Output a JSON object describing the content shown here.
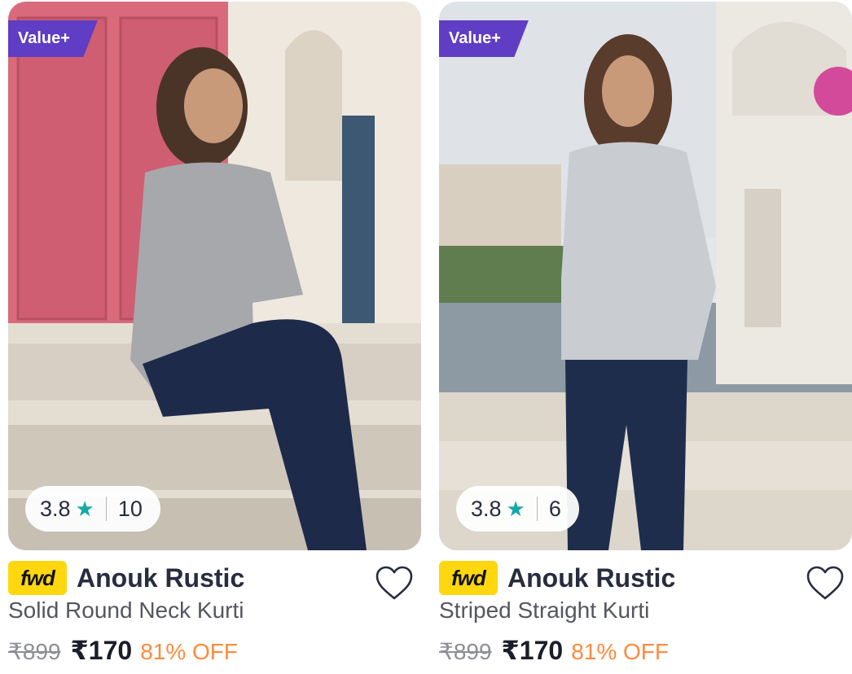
{
  "products": [
    {
      "badge": "Value+",
      "rating": "3.8",
      "star": "★",
      "rating_count": "10",
      "brand_logo": "fwd",
      "brand": "Anouk Rustic",
      "title": "Solid Round Neck Kurti",
      "mrp": "₹899",
      "price": "₹170",
      "discount": "81% OFF",
      "wishlist_icon": "heart-outline-icon"
    },
    {
      "badge": "Value+",
      "rating": "3.8",
      "star": "★",
      "rating_count": "6",
      "brand_logo": "fwd",
      "brand": "Anouk Rustic",
      "title": "Striped Straight Kurti",
      "mrp": "₹899",
      "price": "₹170",
      "discount": "81% OFF",
      "wishlist_icon": "heart-outline-icon"
    }
  ],
  "colors": {
    "badge": "#5f3dc4",
    "star": "#14a8a8",
    "discount": "#ff8a3d",
    "fwd_logo": "#ffd70f"
  }
}
